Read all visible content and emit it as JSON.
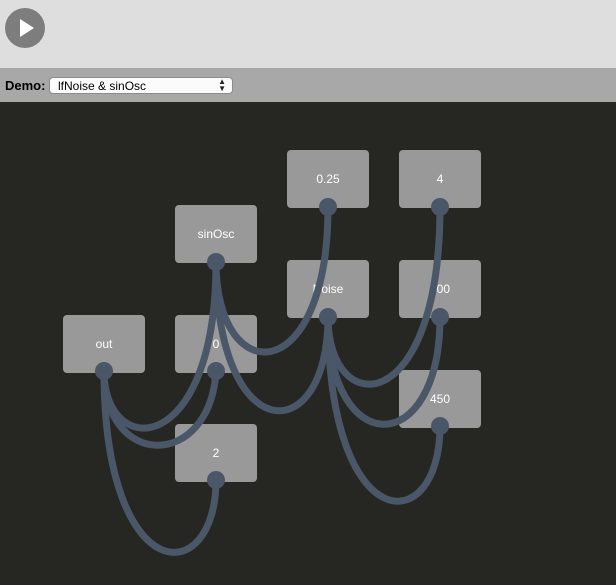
{
  "toolbar": {
    "play_icon": "play-icon"
  },
  "demo": {
    "label": "Demo:",
    "selected": "lfNoise & sinOsc"
  },
  "nodes": [
    {
      "id": "n025",
      "label": "0.25"
    },
    {
      "id": "n4",
      "label": "4"
    },
    {
      "id": "sinOsc",
      "label": "sinOsc"
    },
    {
      "id": "noise",
      "label": "Noise"
    },
    {
      "id": "n400",
      "label": "400"
    },
    {
      "id": "out",
      "label": "out"
    },
    {
      "id": "n0",
      "label": "0"
    },
    {
      "id": "n450",
      "label": "450"
    },
    {
      "id": "n2",
      "label": "2"
    }
  ],
  "colors": {
    "canvas": "#262622",
    "node": "#999999",
    "wire": "#4a5768",
    "play": "#7d7d7d"
  }
}
